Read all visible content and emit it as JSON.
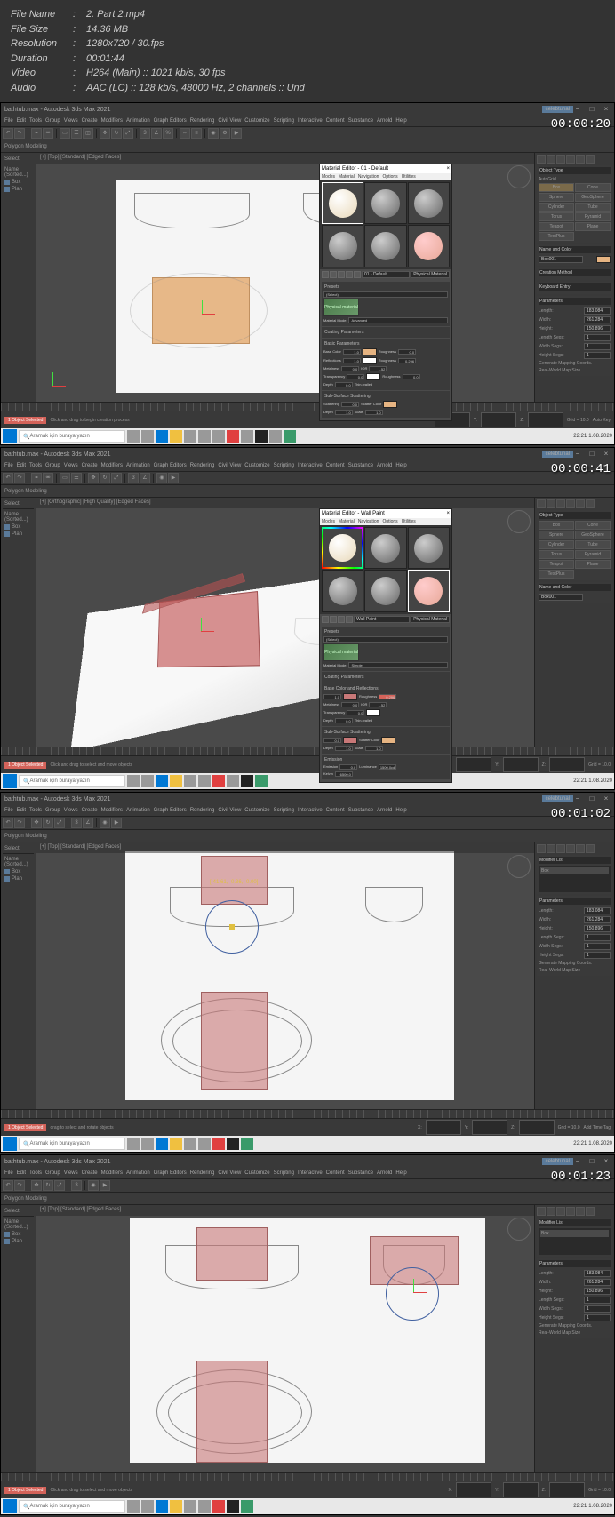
{
  "metadata": {
    "filename_label": "File Name",
    "filename": "2. Part 2.mp4",
    "filesize_label": "File Size",
    "filesize": "14.36 MB",
    "resolution_label": "Resolution",
    "resolution": "1280x720 / 30.fps",
    "duration_label": "Duration",
    "duration": "00:01:44",
    "video_label": "Video",
    "video": "H264 (Main) :: 1021 kb/s, 30 fps",
    "audio_label": "Audio",
    "audio": "AAC (LC) :: 128 kb/s, 48000 Hz, 2 channels :: Und"
  },
  "app": {
    "title": "bathtub.max - Autodesk 3ds Max 2021",
    "menus": [
      "File",
      "Edit",
      "Tools",
      "Group",
      "Views",
      "Create",
      "Modifiers",
      "Animation",
      "Graph Editors",
      "Rendering",
      "Civil View",
      "Customize",
      "Scripting",
      "Interactive",
      "Content",
      "Substance",
      "Arnold",
      "Help"
    ],
    "workspace": "celebtunal",
    "ribbon_label": "Polygon Modeling",
    "left_panel_title": "Select",
    "scene_items": [
      "Name (Sorted...)",
      "Box",
      "Plan"
    ],
    "viewport_labels_ortho": "[+] [Top] [Standard] [Edged Faces]",
    "viewport_labels_persp": "[+] [Orthographic] [High Quality] [Edged Faces]",
    "status_selected": "1 Object Selected",
    "status_hint1": "Click and drag to begin creation process",
    "status_hint2": "Click and drag to select and move objects",
    "status_hint3": "drag to select and rotate objects",
    "coord_labels": [
      "X:",
      "Y:",
      "Z:"
    ],
    "grid_label": "Grid = 10.0",
    "autokey": "Auto Key",
    "addtime": "Add Time Tag"
  },
  "right_panel": {
    "section1": "Object Type",
    "autogrid": "AutoGrid",
    "objects": [
      "Box",
      "Cone",
      "Sphere",
      "GeoSphere",
      "Cylinder",
      "Tube",
      "Torus",
      "Pyramid",
      "Teapot",
      "Plane",
      "TextPlus"
    ],
    "section2": "Name and Color",
    "name_value": "Box001",
    "section3": "Creation Method",
    "section4": "Keyboard Entry",
    "section5": "Parameters",
    "params": [
      {
        "label": "Length:",
        "value": "183.084"
      },
      {
        "label": "Width:",
        "value": "261.284"
      },
      {
        "label": "Height:",
        "value": "150.896"
      },
      {
        "label": "Length Segs:",
        "value": "1"
      },
      {
        "label": "Width Segs:",
        "value": "1"
      },
      {
        "label": "Height Segs:",
        "value": "1"
      }
    ],
    "checkbox1": "Generate Mapping Coords.",
    "checkbox2": "Real-World Map Size",
    "modifier_header": "Modifier List",
    "modifier_item": "Box"
  },
  "material_editor": {
    "title1": "Material Editor - 01 - Default",
    "title2": "Material Editor - Wall Paint",
    "menus": [
      "Modes",
      "Material",
      "Navigation",
      "Options",
      "Utilities"
    ],
    "dropdown1": "01 - Default",
    "dropdown2": "Wall Paint",
    "type": "Physical Material",
    "presets_header": "Presets",
    "preset_value": "(Select)",
    "logo_text": "Physical material",
    "mode_label": "Material Mode:",
    "mode_value1": "Advanced",
    "mode_value2": "Simple",
    "coating_header": "Coating Parameters",
    "basic_header": "Basic Parameters",
    "basic_header2": "Base Color and Reflections",
    "params": [
      {
        "label": "Base Color",
        "val": "1.0"
      },
      {
        "label": "Roughness",
        "val": "0.0"
      },
      {
        "label": "Reflections",
        "val": "1.0"
      },
      {
        "label": "Roughness",
        "val": "0.296"
      },
      {
        "label": "Metalness",
        "val": "0.0"
      },
      {
        "label": "IOR",
        "val": "1.52"
      },
      {
        "label": "Transparency",
        "val": "0.0"
      },
      {
        "label": "Roughness",
        "val": "0.0"
      },
      {
        "label": "Depth",
        "val": "0.0"
      },
      {
        "label": "Thin-walled",
        "val": ""
      }
    ],
    "scattering_header": "Sub-Surface Scattering",
    "scatter_params": [
      {
        "label": "Scattering",
        "val": "0.0"
      },
      {
        "label": "Scatter Color",
        "val": ""
      },
      {
        "label": "Depth",
        "val": "1.0"
      },
      {
        "label": "Scale",
        "val": "1.0"
      }
    ],
    "emission_header": "Emission",
    "emission_params": [
      {
        "label": "Emission",
        "val": "0.0"
      },
      {
        "label": "Luminance",
        "val": "1500.0cd"
      },
      {
        "label": "Kelvin",
        "val": "6500.0"
      }
    ]
  },
  "taskbar": {
    "search_placeholder": "Aramak için buraya yazın",
    "time": "22:21",
    "date": "1.08.2020"
  },
  "timestamps": [
    "00:00:20",
    "00:00:41",
    "00:01:02",
    "00:01:23"
  ],
  "coords_annotation": "[-41.61, -0.36, -0.00]",
  "colors": {
    "orange": "#e6b482",
    "red_transparent": "#c87878",
    "beige_sphere": "#e8d8b8",
    "pink_sphere": "#e8a898",
    "grey_sphere": "#888888"
  }
}
